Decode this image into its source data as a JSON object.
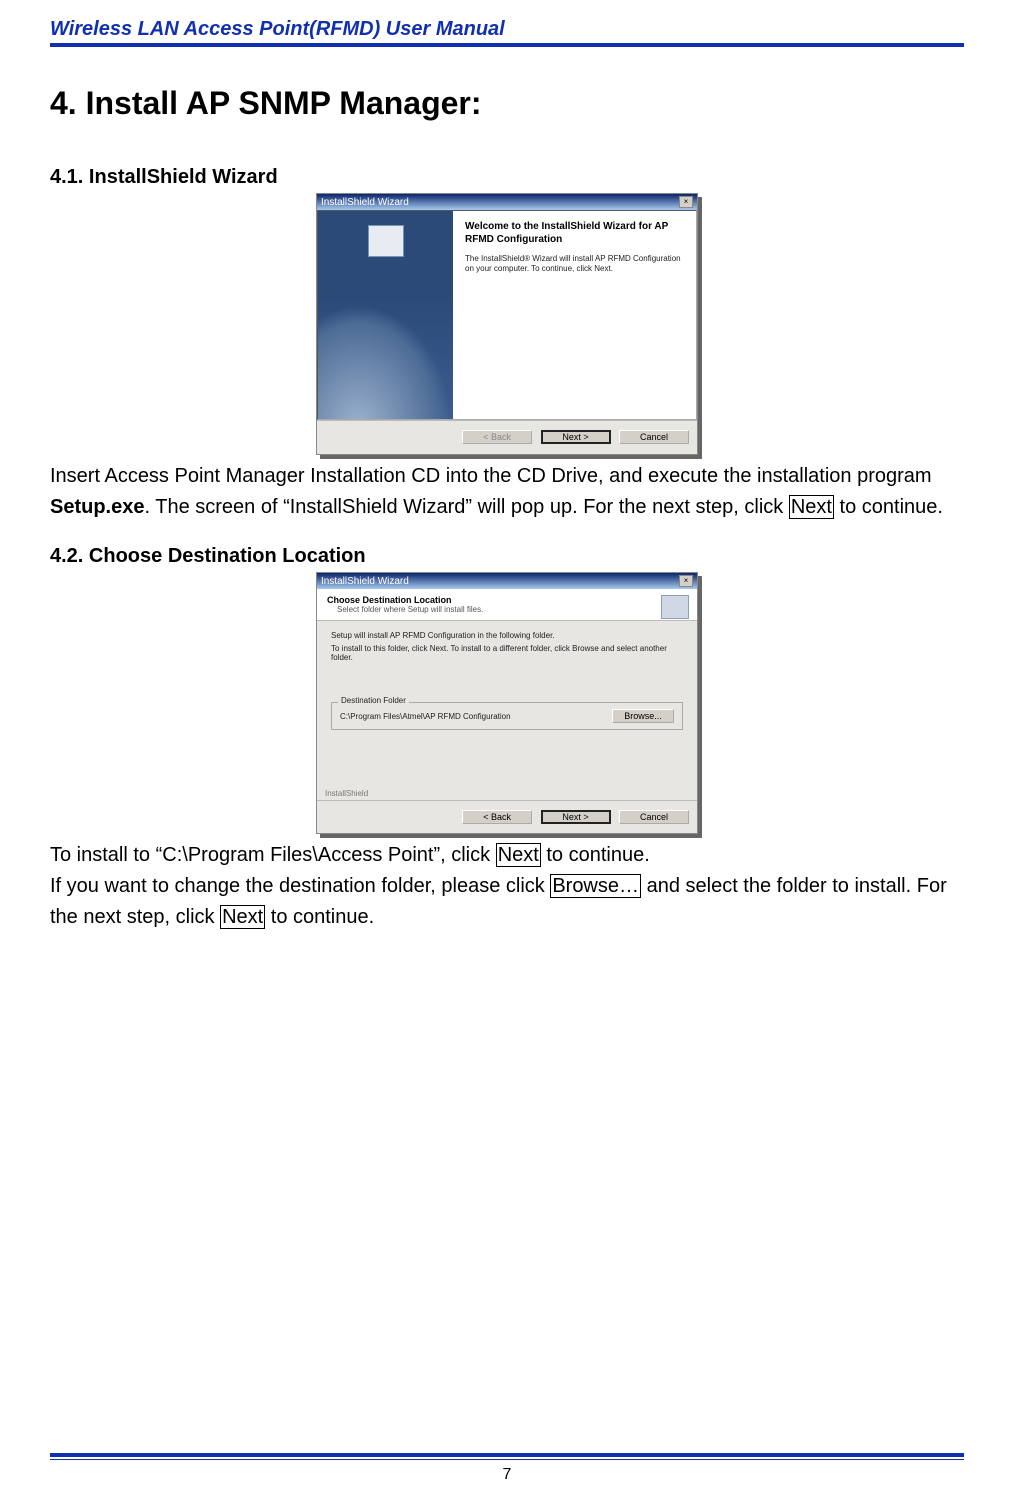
{
  "header": {
    "title": "Wireless LAN Access Point(RFMD) User Manual"
  },
  "h1": {
    "number": "4.",
    "title": "Install AP SNMP Manager:"
  },
  "section1": {
    "number": "4.1.",
    "title": "InstallShield Wizard",
    "wizard": {
      "titlebar": "InstallShield Wizard",
      "heading": "Welcome to the InstallShield Wizard for AP RFMD Configuration",
      "text": "The InstallShield® Wizard will install AP RFMD Configuration on your computer.  To continue, click Next.",
      "buttons": {
        "back": "< Back",
        "next": "Next >",
        "cancel": "Cancel"
      }
    },
    "para_parts": {
      "a": "Insert Access Point Manager Installation CD into the CD Drive, and execute the installation program ",
      "b": "Setup.exe",
      "c": ". The screen of “InstallShield Wizard” will pop up. For the next step, click ",
      "d": "Next",
      "e": " to continue."
    }
  },
  "section2": {
    "number": "4.2.",
    "title": "Choose Destination Location",
    "wizard": {
      "titlebar": "InstallShield Wizard",
      "head_title": "Choose Destination Location",
      "head_sub": "Select folder where Setup will install files.",
      "line1": "Setup will install AP RFMD Configuration in the following folder.",
      "line2": "To install to this folder, click Next. To install to a different folder, click Browse and select another folder.",
      "group_label": "Destination Folder",
      "path": "C:\\Program Files\\Atmel\\AP RFMD Configuration",
      "browse": "Browse...",
      "buttons": {
        "back": "< Back",
        "next": "Next >",
        "cancel": "Cancel"
      },
      "brand": "InstallShield"
    },
    "para_parts": {
      "a": "To install to “C:\\Program Files\\Access Point”, click ",
      "b": "Next",
      "c": " to continue.",
      "d": "If you want to change the destination folder, please click ",
      "e": "Browse…",
      "f": " and select the folder to install. For the next step, click ",
      "g": "Next",
      "h": " to continue."
    }
  },
  "footer": {
    "page_number": "7"
  }
}
